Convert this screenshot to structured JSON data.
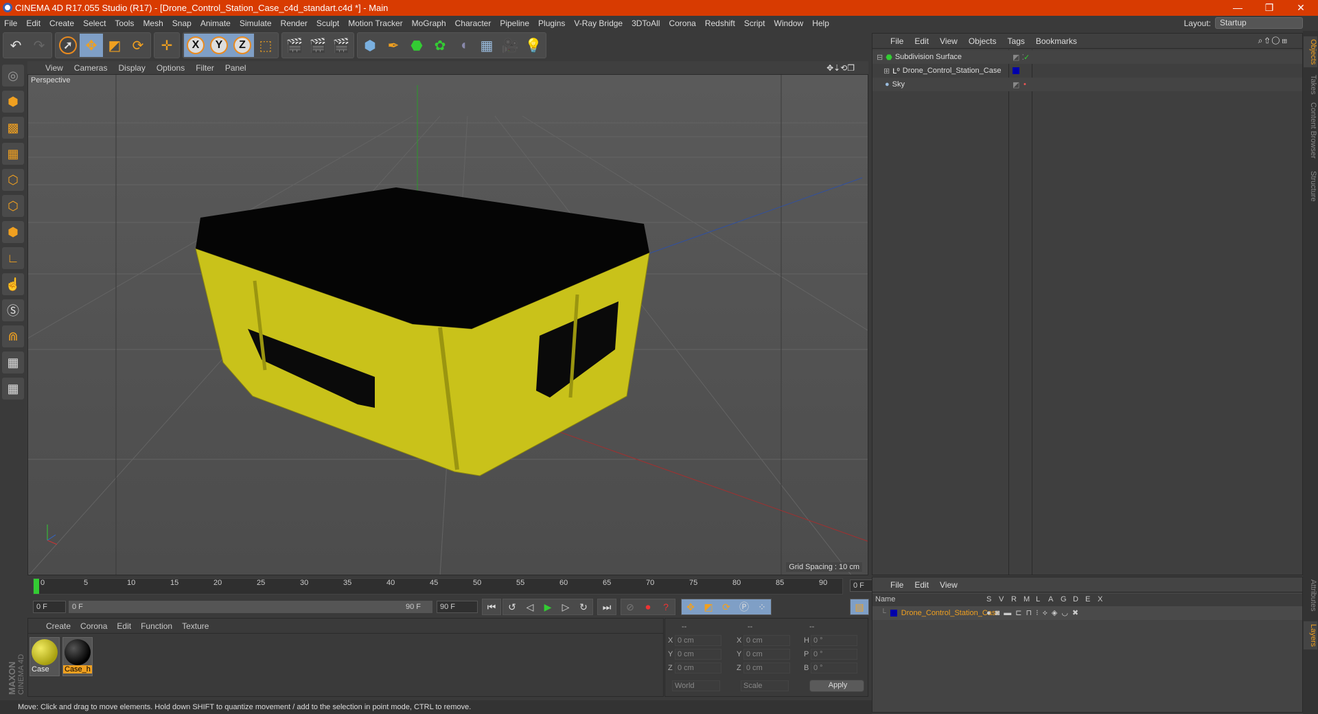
{
  "window": {
    "title": "CINEMA 4D R17.055 Studio (R17) - [Drone_Control_Station_Case_c4d_standart.c4d *] - Main",
    "minimize": "—",
    "restore": "❐",
    "close": "✕"
  },
  "menu": [
    "File",
    "Edit",
    "Create",
    "Select",
    "Tools",
    "Mesh",
    "Snap",
    "Animate",
    "Simulate",
    "Render",
    "Sculpt",
    "Motion Tracker",
    "MoGraph",
    "Character",
    "Pipeline",
    "Plugins",
    "V-Ray Bridge",
    "3DToAll",
    "Corona",
    "Redshift",
    "Script",
    "Window",
    "Help"
  ],
  "layout": {
    "label": "Layout:",
    "value": "Startup"
  },
  "toolbar": {
    "x": "X",
    "y": "Y",
    "z": "Z"
  },
  "viewport": {
    "menu": [
      "View",
      "Cameras",
      "Display",
      "Options",
      "Filter",
      "Panel"
    ],
    "label": "Perspective",
    "grid_spacing": "Grid Spacing : 10 cm"
  },
  "timeline": {
    "ticks": [
      "0",
      "5",
      "10",
      "15",
      "20",
      "25",
      "30",
      "35",
      "40",
      "45",
      "50",
      "55",
      "60",
      "65",
      "70",
      "75",
      "80",
      "85",
      "90"
    ],
    "current": "0 F",
    "start": "0 F",
    "range_start": "0 F",
    "range_end": "90 F",
    "end": "90 F"
  },
  "materials": {
    "menu": [
      "Create",
      "Corona",
      "Edit",
      "Function",
      "Texture"
    ],
    "items": [
      {
        "name": "Case",
        "color": "#c8c020"
      },
      {
        "name": "Case_h",
        "color": "#111111"
      }
    ]
  },
  "coords": {
    "headers": [
      "--",
      "--",
      "--"
    ],
    "rows": [
      {
        "a": "X",
        "av": "0 cm",
        "b": "X",
        "bv": "0 cm",
        "c": "H",
        "cv": "0 °"
      },
      {
        "a": "Y",
        "av": "0 cm",
        "b": "Y",
        "bv": "0 cm",
        "c": "P",
        "cv": "0 °"
      },
      {
        "a": "Z",
        "av": "0 cm",
        "b": "Z",
        "bv": "0 cm",
        "c": "B",
        "cv": "0 °"
      }
    ],
    "mode": "World",
    "type": "Scale",
    "apply": "Apply"
  },
  "status": "Move: Click and drag to move elements. Hold down SHIFT to quantize movement / add to the selection in point mode, CTRL to remove.",
  "objects": {
    "menu": [
      "File",
      "Edit",
      "View",
      "Objects",
      "Tags",
      "Bookmarks"
    ],
    "items": [
      {
        "name": "Subdivision Surface",
        "icon": "subdivision-icon"
      },
      {
        "name": "Drone_Control_Station_Case",
        "icon": "null-icon",
        "color": "#0000aa"
      },
      {
        "name": "Sky",
        "icon": "sky-icon"
      }
    ]
  },
  "layers": {
    "menu": [
      "File",
      "Edit",
      "View"
    ],
    "columns": [
      "Name",
      "S",
      "V",
      "R",
      "M",
      "L",
      "A",
      "G",
      "D",
      "E",
      "X"
    ],
    "items": [
      {
        "name": "Drone_Control_Station_Case",
        "color": "#0000aa"
      }
    ]
  },
  "side_tabs": [
    "Objects",
    "Takes",
    "Content Browser",
    "Structure",
    "Attributes",
    "Layers"
  ],
  "brand": "MAXON CINEMA 4D",
  "colors": {
    "accent": "#d83b01",
    "selected": "#f0a020"
  }
}
